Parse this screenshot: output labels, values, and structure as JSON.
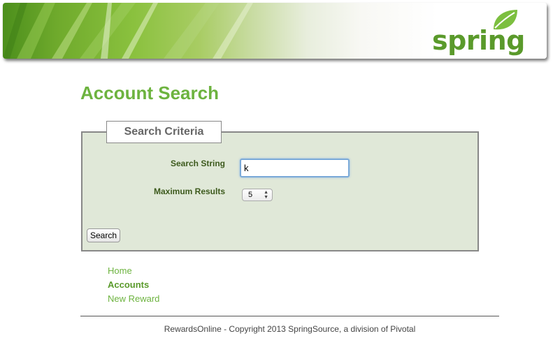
{
  "header": {
    "logo_text": "spring",
    "logo_icon": "leaf-icon",
    "colors": {
      "brand_green": "#6db33f",
      "dark_green": "#5a9a2b"
    }
  },
  "page": {
    "title": "Account Search"
  },
  "criteria": {
    "legend": "Search Criteria",
    "search_string_label": "Search String",
    "search_string_value": "k",
    "max_results_label": "Maximum Results",
    "max_results_value": "5",
    "search_button_label": "Search"
  },
  "nav": {
    "items": [
      {
        "label": "Home",
        "active": false
      },
      {
        "label": "Accounts",
        "active": true
      },
      {
        "label": "New Reward",
        "active": false
      }
    ]
  },
  "footer": {
    "text": "RewardsOnline - Copyright 2013 SpringSource, a division of Pivotal"
  }
}
